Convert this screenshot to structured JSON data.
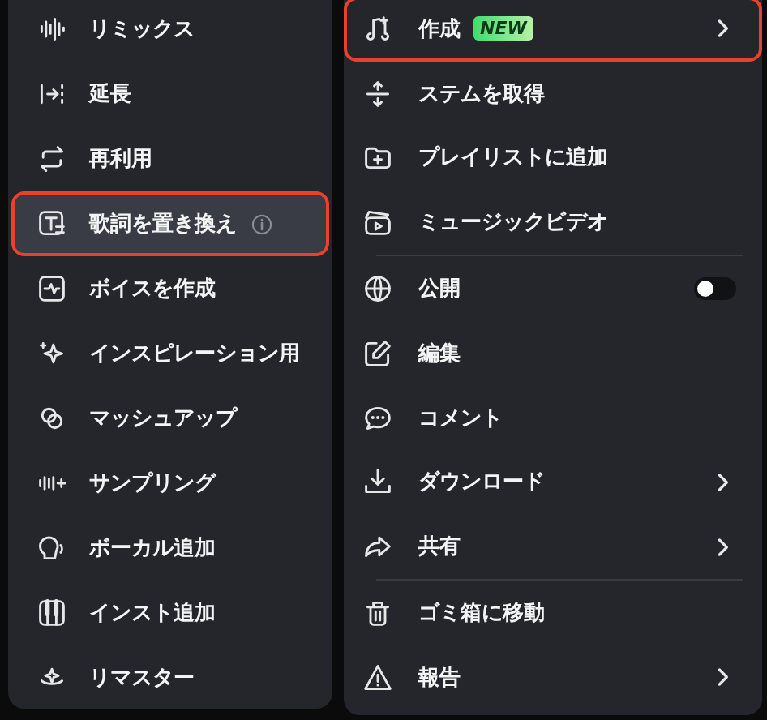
{
  "left_menu": {
    "items": [
      {
        "label": "リミックス",
        "selected": false,
        "outlined": false
      },
      {
        "label": "延長",
        "selected": false,
        "outlined": false
      },
      {
        "label": "再利用",
        "selected": false,
        "outlined": false
      },
      {
        "label": "歌詞を置き換え",
        "selected": true,
        "outlined": true,
        "info": true
      },
      {
        "label": "ボイスを作成",
        "selected": false,
        "outlined": false
      },
      {
        "label": "インスピレーション用",
        "selected": false,
        "outlined": false
      },
      {
        "label": "マッシュアップ",
        "selected": false,
        "outlined": false
      },
      {
        "label": "サンプリング",
        "selected": false,
        "outlined": false
      },
      {
        "label": "ボーカル追加",
        "selected": false,
        "outlined": false
      },
      {
        "label": "インスト追加",
        "selected": false,
        "outlined": false
      },
      {
        "label": "リマスター",
        "selected": false,
        "outlined": false
      }
    ]
  },
  "right_menu": {
    "items": [
      {
        "kind": "submenu",
        "label": "作成",
        "badge": "NEW",
        "outlined": true
      },
      {
        "kind": "action",
        "label": "ステムを取得",
        "outlined": false
      },
      {
        "kind": "action",
        "label": "プレイリストに追加",
        "outlined": false
      },
      {
        "kind": "action",
        "label": "ミュージックビデオ",
        "outlined": false
      },
      {
        "kind": "divider"
      },
      {
        "kind": "toggle",
        "label": "公開",
        "on": false,
        "outlined": false
      },
      {
        "kind": "action",
        "label": "編集",
        "outlined": false
      },
      {
        "kind": "action",
        "label": "コメント",
        "outlined": false
      },
      {
        "kind": "submenu",
        "label": "ダウンロード",
        "outlined": false
      },
      {
        "kind": "submenu",
        "label": "共有",
        "outlined": false
      },
      {
        "kind": "divider"
      },
      {
        "kind": "action",
        "label": "ゴミ箱に移動",
        "outlined": false
      },
      {
        "kind": "submenu",
        "label": "報告",
        "outlined": false
      }
    ]
  }
}
